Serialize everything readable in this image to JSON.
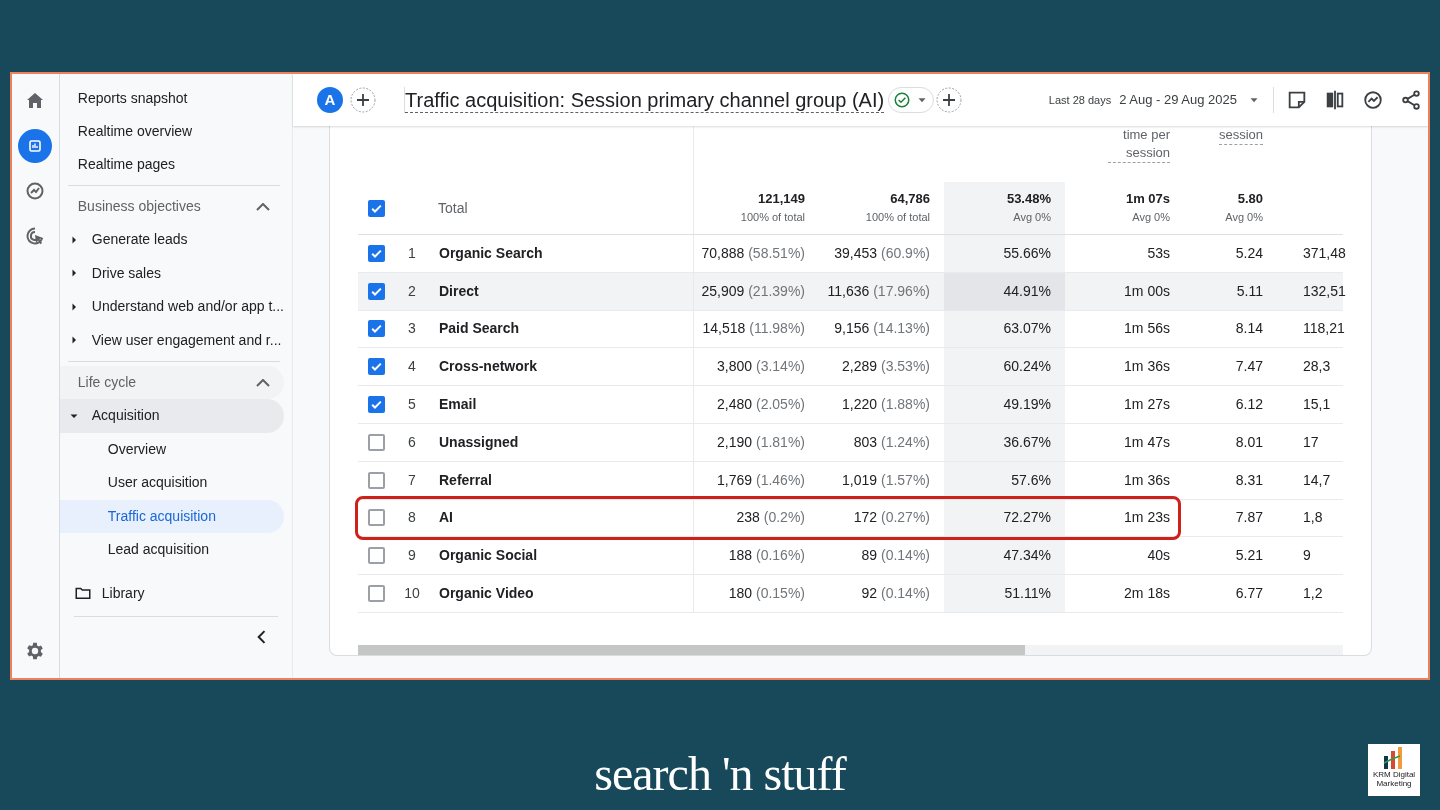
{
  "rail": [
    {
      "kind": "home",
      "selected": false
    },
    {
      "kind": "reports",
      "selected": true
    },
    {
      "kind": "explore",
      "selected": false
    },
    {
      "kind": "advertising",
      "selected": false
    }
  ],
  "sidebar": {
    "top_items": [
      {
        "label": "Reports snapshot",
        "selected": false
      },
      {
        "label": "Realtime overview",
        "selected": false
      },
      {
        "label": "Realtime pages",
        "selected": false
      }
    ],
    "sections": [
      {
        "title": "Business objectives",
        "expanded": true,
        "items": [
          {
            "label": "Generate leads",
            "expanded": false
          },
          {
            "label": "Drive sales",
            "expanded": false
          },
          {
            "label": "Understand web and/or app t...",
            "expanded": false
          },
          {
            "label": "View user engagement and r...",
            "expanded": false
          }
        ]
      },
      {
        "title": "Life cycle",
        "expanded": true,
        "items": [
          {
            "label": "Acquisition",
            "expanded": true,
            "children": [
              {
                "label": "Overview",
                "selected": false
              },
              {
                "label": "User acquisition",
                "selected": false
              },
              {
                "label": "Traffic acquisition",
                "selected": true
              },
              {
                "label": "Lead acquisition",
                "selected": false
              }
            ]
          }
        ]
      }
    ],
    "library": "Library"
  },
  "header": {
    "avatar": "A",
    "title": "Traffic acquisition: Session primary channel group (AI)",
    "date_range_label": "Last 28 days",
    "date_range": "2 Aug - 29 Aug 2025"
  },
  "table": {
    "columns": [
      {
        "sorted": false
      },
      {
        "sorted": false
      },
      {
        "sorted": true
      },
      {
        "sorted": false,
        "heading": "time per session"
      },
      {
        "sorted": false,
        "heading": "session"
      },
      {
        "sorted": false
      }
    ],
    "total": {
      "label": "Total",
      "checked": true,
      "cells": [
        {
          "value": "121,149",
          "sub": "100% of total"
        },
        {
          "value": "64,786",
          "sub": "100% of total"
        },
        {
          "value": "53.48%",
          "sub": "Avg 0%"
        },
        {
          "value": "1m 07s",
          "sub": "Avg 0%"
        },
        {
          "value": "5.80",
          "sub": "Avg 0%"
        }
      ]
    },
    "rows": [
      {
        "rank": "1",
        "name": "Organic Search",
        "checked": true,
        "hovered": false,
        "outlined": false,
        "cells": [
          {
            "value": "70,888",
            "share": "(58.51%)"
          },
          {
            "value": "39,453",
            "share": "(60.9%)"
          },
          {
            "value": "55.66%"
          },
          {
            "value": "53s"
          },
          {
            "value": "5.24"
          },
          {
            "value": "371,48"
          }
        ]
      },
      {
        "rank": "2",
        "name": "Direct",
        "checked": true,
        "hovered": true,
        "outlined": false,
        "cells": [
          {
            "value": "25,909",
            "share": "(21.39%)"
          },
          {
            "value": "11,636",
            "share": "(17.96%)"
          },
          {
            "value": "44.91%"
          },
          {
            "value": "1m 00s"
          },
          {
            "value": "5.11"
          },
          {
            "value": "132,51"
          }
        ]
      },
      {
        "rank": "3",
        "name": "Paid Search",
        "checked": true,
        "hovered": false,
        "outlined": false,
        "cells": [
          {
            "value": "14,518",
            "share": "(11.98%)"
          },
          {
            "value": "9,156",
            "share": "(14.13%)"
          },
          {
            "value": "63.07%"
          },
          {
            "value": "1m 56s"
          },
          {
            "value": "8.14"
          },
          {
            "value": "118,21"
          }
        ]
      },
      {
        "rank": "4",
        "name": "Cross-network",
        "checked": true,
        "hovered": false,
        "outlined": false,
        "cells": [
          {
            "value": "3,800",
            "share": "(3.14%)"
          },
          {
            "value": "2,289",
            "share": "(3.53%)"
          },
          {
            "value": "60.24%"
          },
          {
            "value": "1m 36s"
          },
          {
            "value": "7.47"
          },
          {
            "value": "28,3"
          }
        ]
      },
      {
        "rank": "5",
        "name": "Email",
        "checked": true,
        "hovered": false,
        "outlined": false,
        "cells": [
          {
            "value": "2,480",
            "share": "(2.05%)"
          },
          {
            "value": "1,220",
            "share": "(1.88%)"
          },
          {
            "value": "49.19%"
          },
          {
            "value": "1m 27s"
          },
          {
            "value": "6.12"
          },
          {
            "value": "15,1"
          }
        ]
      },
      {
        "rank": "6",
        "name": "Unassigned",
        "checked": false,
        "hovered": false,
        "outlined": false,
        "cells": [
          {
            "value": "2,190",
            "share": "(1.81%)"
          },
          {
            "value": "803",
            "share": "(1.24%)"
          },
          {
            "value": "36.67%"
          },
          {
            "value": "1m 47s"
          },
          {
            "value": "8.01"
          },
          {
            "value": "17"
          }
        ]
      },
      {
        "rank": "7",
        "name": "Referral",
        "checked": false,
        "hovered": false,
        "outlined": false,
        "cells": [
          {
            "value": "1,769",
            "share": "(1.46%)"
          },
          {
            "value": "1,019",
            "share": "(1.57%)"
          },
          {
            "value": "57.6%"
          },
          {
            "value": "1m 36s"
          },
          {
            "value": "8.31"
          },
          {
            "value": "14,7"
          }
        ]
      },
      {
        "rank": "8",
        "name": "AI",
        "checked": false,
        "hovered": false,
        "outlined": true,
        "cells": [
          {
            "value": "238",
            "share": "(0.2%)"
          },
          {
            "value": "172",
            "share": "(0.27%)"
          },
          {
            "value": "72.27%"
          },
          {
            "value": "1m 23s"
          },
          {
            "value": "7.87"
          },
          {
            "value": "1,8"
          }
        ]
      },
      {
        "rank": "9",
        "name": "Organic Social",
        "checked": false,
        "hovered": false,
        "outlined": false,
        "cells": [
          {
            "value": "188",
            "share": "(0.16%)"
          },
          {
            "value": "89",
            "share": "(0.14%)"
          },
          {
            "value": "47.34%"
          },
          {
            "value": "40s"
          },
          {
            "value": "5.21"
          },
          {
            "value": "9"
          }
        ]
      },
      {
        "rank": "10",
        "name": "Organic Video",
        "checked": false,
        "hovered": false,
        "outlined": false,
        "cells": [
          {
            "value": "180",
            "share": "(0.15%)"
          },
          {
            "value": "92",
            "share": "(0.14%)"
          },
          {
            "value": "51.11%"
          },
          {
            "value": "2m 18s"
          },
          {
            "value": "6.77"
          },
          {
            "value": "1,2"
          }
        ]
      }
    ]
  },
  "footer": {
    "brand": "search 'n stuff",
    "logo_lines": [
      "KRM Digital",
      "Marketing"
    ]
  }
}
